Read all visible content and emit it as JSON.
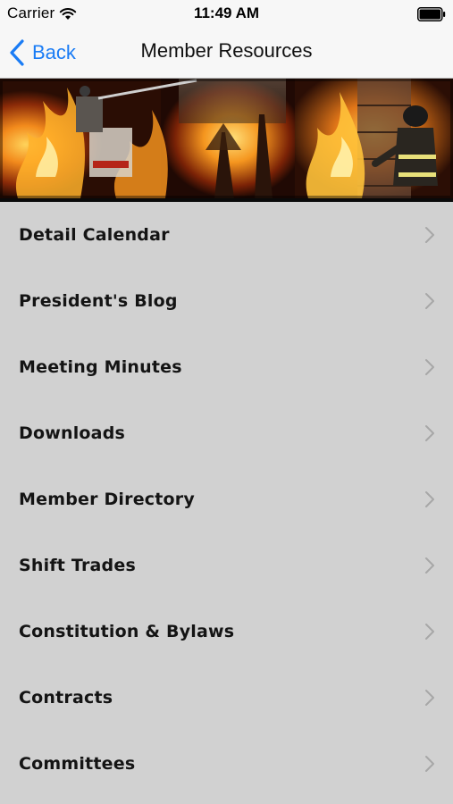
{
  "status_bar": {
    "carrier": "Carrier",
    "time": "11:49 AM"
  },
  "nav": {
    "back_label": "Back",
    "title": "Member Resources",
    "accent_color": "#1a7cf5"
  },
  "menu": {
    "items": [
      {
        "label": "Detail Calendar"
      },
      {
        "label": "President's Blog"
      },
      {
        "label": "Meeting Minutes"
      },
      {
        "label": "Downloads"
      },
      {
        "label": "Member Directory"
      },
      {
        "label": "Shift Trades"
      },
      {
        "label": "Constitution & Bylaws"
      },
      {
        "label": "Contracts"
      },
      {
        "label": "Committees"
      }
    ]
  },
  "icons": {
    "wifi": "wifi-icon",
    "battery": "battery-icon",
    "back": "chevron-left-icon",
    "row_disclosure": "chevron-right-icon"
  }
}
